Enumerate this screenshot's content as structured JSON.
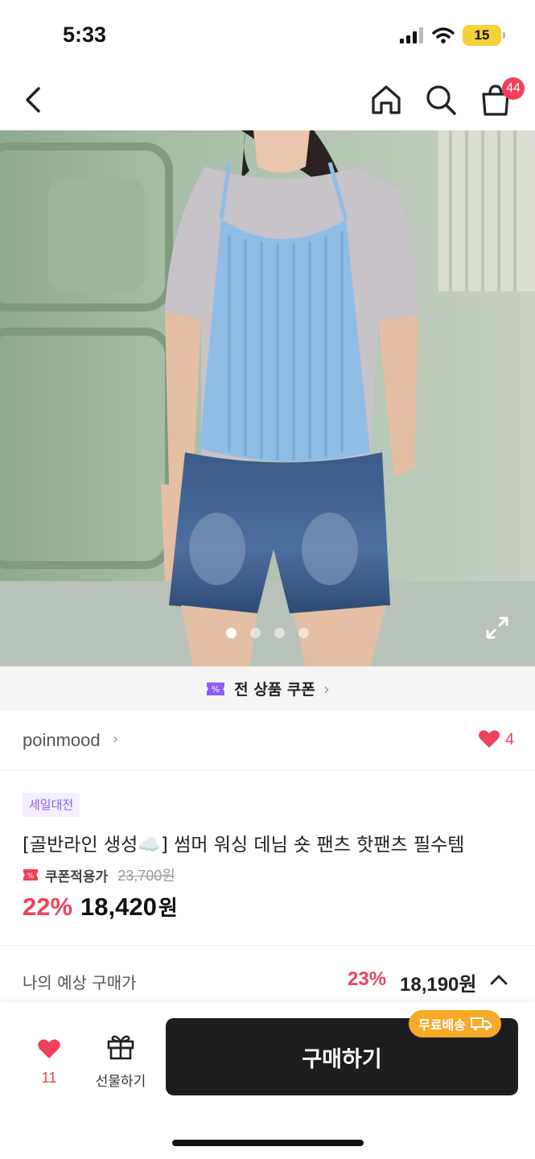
{
  "status_bar": {
    "time": "5:33",
    "battery": "15"
  },
  "nav": {
    "cart_badge": "44"
  },
  "hero": {
    "dots_total": 4,
    "active_dot": 0
  },
  "coupon_strip": {
    "label": "전 상품 쿠폰"
  },
  "brand": {
    "name": "poinmood",
    "like_count": "4"
  },
  "product": {
    "sale_badge": "세일대전",
    "title": "[골반라인 생성☁️] 썸머 워싱 데님 숏 팬츠 핫팬츠 필수템",
    "coupon_price_label": "쿠폰적용가",
    "original_price": "23,700원",
    "discount_rate": "22%",
    "sale_price": "18,420",
    "sale_price_unit": "원"
  },
  "expected": {
    "label": "나의 예상 구매가",
    "rate": "23%",
    "price": "18,190원"
  },
  "bottom_bar": {
    "wish_count": "11",
    "gift_label": "선물하기",
    "buy_label": "구매하기",
    "free_shipping": "무료배송"
  },
  "colors": {
    "accent": "#f0405a",
    "purple": "#8b5cf6",
    "buy_button": "#1d1d1f",
    "shipping_badge": "#f7a928"
  }
}
